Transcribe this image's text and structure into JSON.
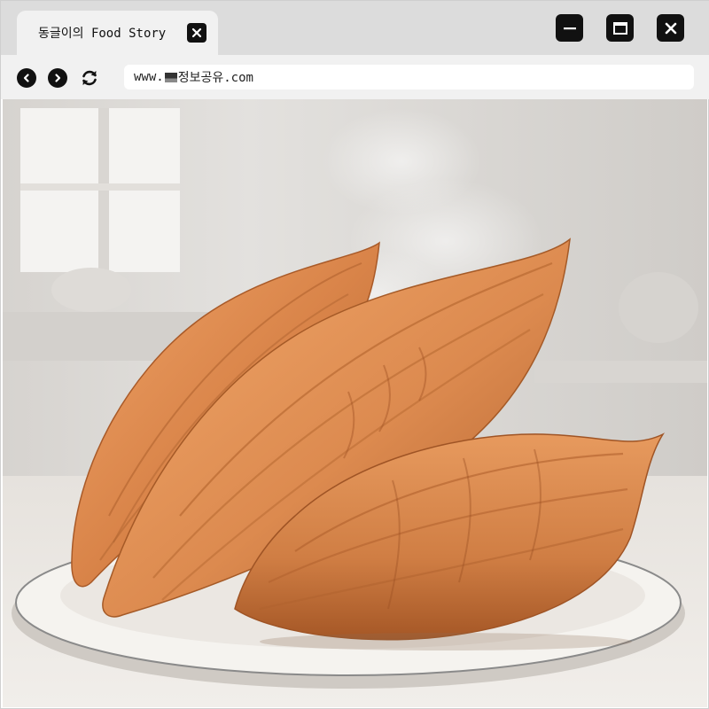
{
  "tab": {
    "title": "동글이의 Food Story"
  },
  "address_bar": {
    "url_prefix": "www.",
    "url_suffix": "정보공유.com"
  },
  "icons": {
    "tab_close": "close-icon",
    "minimize": "minimize-icon",
    "maximize": "maximize-icon",
    "close": "close-icon",
    "back": "chevron-left-icon",
    "forward": "chevron-right-icon",
    "reload": "reload-icon",
    "flag": "flag-icon"
  },
  "colors": {
    "chrome_dark": "#dcdcdc",
    "chrome_light": "#f1f1f1",
    "button": "#111111",
    "potato": "#d9854a"
  },
  "image": {
    "subject": "roasted-sweet-potatoes",
    "count": 3
  }
}
